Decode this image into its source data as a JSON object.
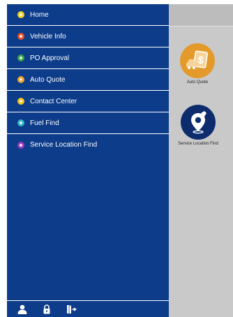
{
  "menu": {
    "items": [
      {
        "label": "Home",
        "icon": "home-icon",
        "color": "#f2d325"
      },
      {
        "label": "Vehicle Info",
        "icon": "vehicle-info-icon",
        "color": "#e8522a"
      },
      {
        "label": "PO Approval",
        "icon": "po-approval-icon",
        "color": "#3aa648"
      },
      {
        "label": "Auto Quote",
        "icon": "auto-quote-icon",
        "color": "#f0a22c"
      },
      {
        "label": "Contact Center",
        "icon": "contact-center-icon",
        "color": "#f2c21f"
      },
      {
        "label": "Fuel Find",
        "icon": "fuel-find-icon",
        "color": "#2fb6c7"
      },
      {
        "label": "Service Location Find",
        "icon": "service-location-icon",
        "color": "#9a3dbf"
      }
    ]
  },
  "bottom_bar": {
    "icons": [
      "user-icon",
      "lock-icon",
      "logout-icon"
    ]
  },
  "tiles": [
    {
      "label": "Auto Quote",
      "icon": "auto-quote-tile-icon",
      "color": "#e39a2a"
    },
    {
      "label": "Service Location Find",
      "icon": "service-location-tile-icon",
      "color": "#0d2c6e"
    }
  ],
  "colors": {
    "drawer": "#0d3c8a",
    "panel": "#c9c9c9"
  }
}
